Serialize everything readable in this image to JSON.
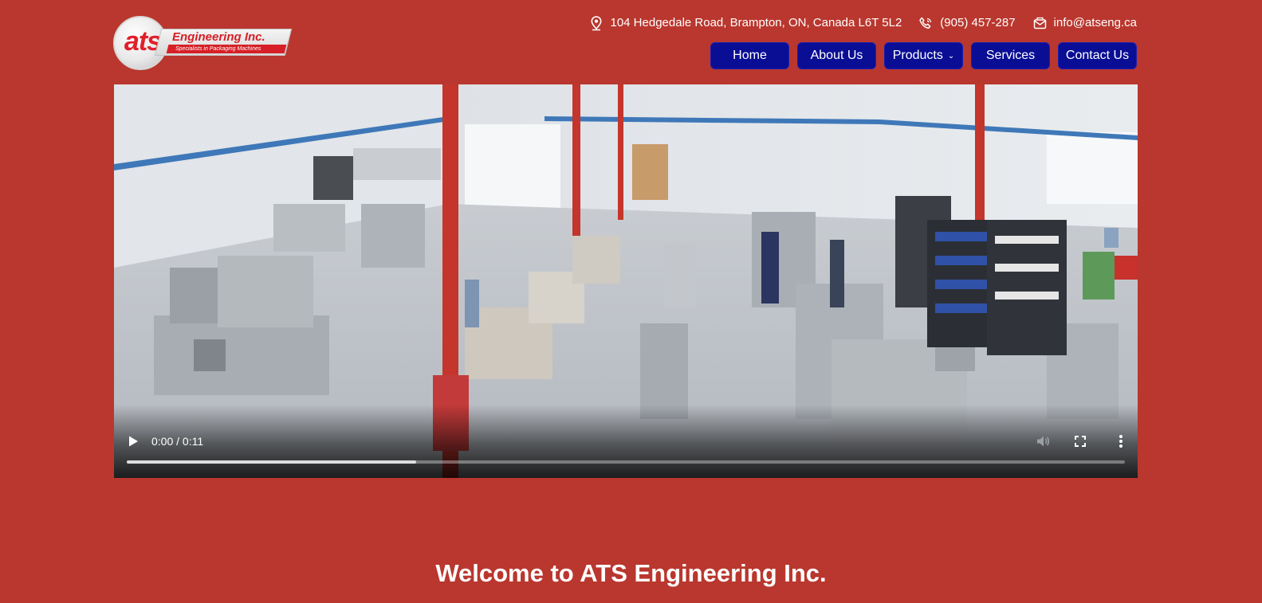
{
  "brand": {
    "logo_mark": "ats",
    "logo_name": "Engineering Inc.",
    "logo_tagline": "Specialists in Packaging Machines"
  },
  "contact": {
    "address": "104 Hedgedale Road, Brampton, ON, Canada L6T 5L2",
    "phone": "(905) 457-287",
    "email": "info@atseng.ca",
    "icons": [
      "map-pin-icon",
      "phone-icon",
      "mail-icon"
    ]
  },
  "nav": {
    "items": [
      {
        "label": "Home"
      },
      {
        "label": "About Us"
      },
      {
        "label": "Products",
        "has_dropdown": true
      },
      {
        "label": "Services"
      },
      {
        "label": "Contact Us"
      }
    ]
  },
  "video": {
    "time_display": "0:00 / 0:11",
    "buffered_fraction": 0.29,
    "controls": [
      "play-icon",
      "volume-icon",
      "fullscreen-icon",
      "more-options-icon"
    ]
  },
  "welcome": {
    "heading": "Welcome to ATS Engineering Inc."
  },
  "colors": {
    "page_background": "#b9372e",
    "nav_button": "#0a0e94",
    "logo_red": "#d61f26"
  }
}
